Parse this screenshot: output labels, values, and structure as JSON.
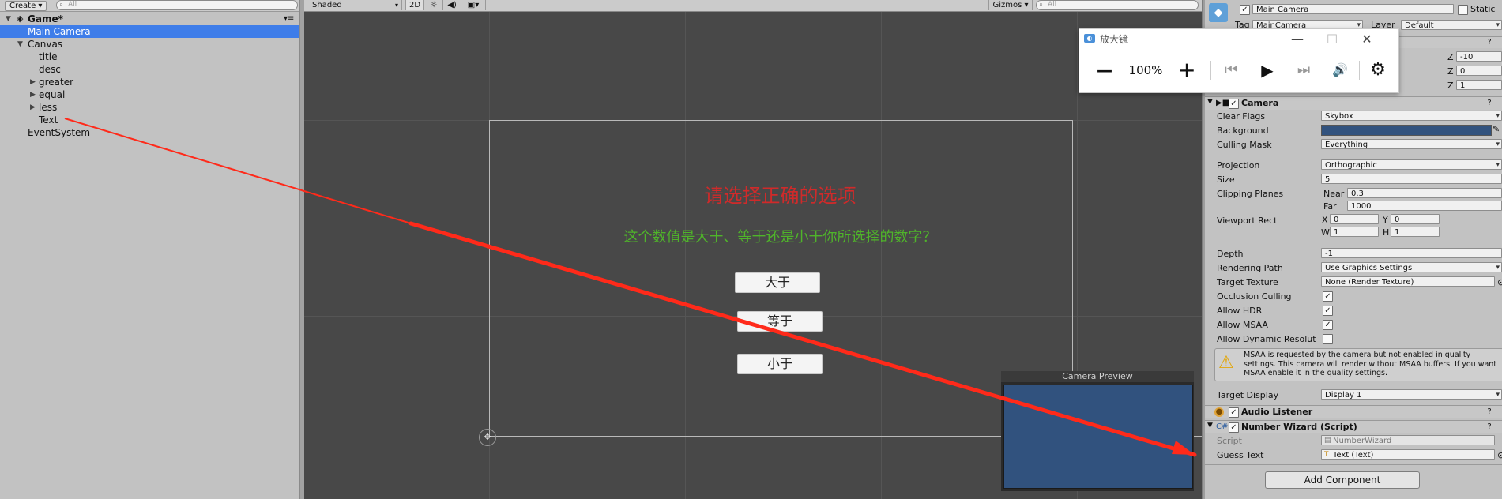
{
  "hierarchy": {
    "create_label": "Create",
    "search_placeholder": "All",
    "scene_name": "Game*",
    "items": [
      {
        "label": "Main Camera"
      },
      {
        "label": "Canvas"
      },
      {
        "label": "title"
      },
      {
        "label": "desc"
      },
      {
        "label": "greater"
      },
      {
        "label": "equal"
      },
      {
        "label": "less"
      },
      {
        "label": "Text"
      },
      {
        "label": "EventSystem"
      }
    ]
  },
  "scene_toolbar": {
    "shading_mode": "Shaded",
    "mode_2d": "2D",
    "gizmos_label": "Gizmos",
    "search_placeholder": "All"
  },
  "scene": {
    "title_text": "请选择正确的选项",
    "desc_text": "这个数值是大于、等于还是小于你所选择的数字？",
    "buttons": [
      "大于",
      "等于",
      "小于"
    ],
    "camera_preview_title": "Camera Preview",
    "camera_preview_color": "#31527e"
  },
  "magnifier": {
    "title": "放大镜",
    "zoom": "100%",
    "minimize_glyph": "—",
    "maximize_glyph": "☐",
    "close_glyph": "✕",
    "zoom_out_glyph": "—",
    "zoom_in_glyph": "+",
    "prev_glyph": "⏮",
    "play_glyph": "▶",
    "next_glyph": "⏭",
    "read_glyph": "🔊",
    "settings_glyph": "⚙"
  },
  "inspector": {
    "object_name": "Main Camera",
    "static_label": "Static",
    "tag_label": "Tag",
    "tag_value": "MainCamera",
    "layer_label": "Layer",
    "layer_value": "Default",
    "transform_values": {
      "z1": "-10",
      "z2": "0",
      "z3": "1"
    },
    "z_label": "Z",
    "camera": {
      "header": "Camera",
      "clear_flags_label": "Clear Flags",
      "clear_flags_value": "Skybox",
      "background_label": "Background",
      "background_color": "#31527e",
      "culling_mask_label": "Culling Mask",
      "culling_mask_value": "Everything",
      "projection_label": "Projection",
      "projection_value": "Orthographic",
      "size_label": "Size",
      "size_value": "5",
      "clipping_planes_label": "Clipping Planes",
      "near_label": "Near",
      "near_value": "0.3",
      "far_label": "Far",
      "far_value": "1000",
      "viewport_rect_label": "Viewport Rect",
      "x_label": "X",
      "x_value": "0",
      "y_label": "Y",
      "y_value": "0",
      "w_label": "W",
      "w_value": "1",
      "h_label": "H",
      "h_value": "1",
      "depth_label": "Depth",
      "depth_value": "-1",
      "rendering_path_label": "Rendering Path",
      "rendering_path_value": "Use Graphics Settings",
      "target_texture_label": "Target Texture",
      "target_texture_value": "None (Render Texture)",
      "occlusion_culling_label": "Occlusion Culling",
      "allow_hdr_label": "Allow HDR",
      "allow_msaa_label": "Allow MSAA",
      "allow_dynamic_label": "Allow Dynamic Resolut",
      "warning_text": "MSAA is requested by the camera but not enabled in quality settings. This camera will render without MSAA buffers. If you want MSAA enable it in the quality settings.",
      "target_display_label": "Target Display",
      "target_display_value": "Display 1"
    },
    "audio_listener_header": "Audio Listener",
    "number_wizard": {
      "header": "Number Wizard (Script)",
      "script_label": "Script",
      "script_value": "NumberWizard",
      "guess_text_label": "Guess Text",
      "guess_text_value": "Text (Text)"
    },
    "add_component_label": "Add Component"
  },
  "colors": {
    "selection": "#3e7de9",
    "annotation_arrow": "#ff2a1a",
    "scene_bg": "#484848"
  }
}
